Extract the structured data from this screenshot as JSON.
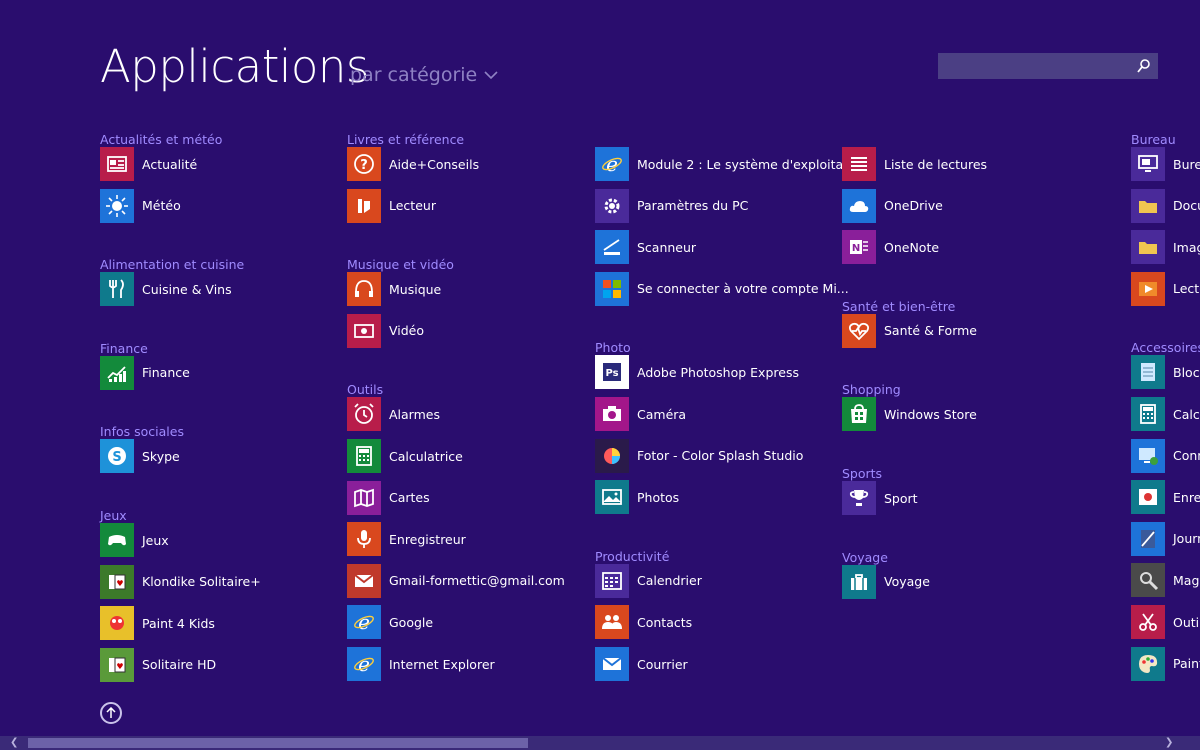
{
  "header": {
    "title": "Applications",
    "sort_label": "par catégorie",
    "search_placeholder": ""
  },
  "colors": {
    "background": "#2a0d6e",
    "section_head": "#a08bff",
    "search_bg": "#4b3f84"
  },
  "columns": [
    {
      "sections": [
        {
          "head": "Actualités et météo",
          "apps": [
            {
              "label": "Actualité",
              "icon": "news-icon",
              "color": "#b81d4a"
            },
            {
              "label": "Météo",
              "icon": "sun-icon",
              "color": "#1e73d9"
            }
          ]
        },
        {
          "head": "Alimentation et cuisine",
          "apps": [
            {
              "label": "Cuisine & Vins",
              "icon": "fork-knife-icon",
              "color": "#0f7a8c"
            }
          ]
        },
        {
          "head": "Finance",
          "apps": [
            {
              "label": "Finance",
              "icon": "chart-icon",
              "color": "#138a3b"
            }
          ]
        },
        {
          "head": "Infos sociales",
          "apps": [
            {
              "label": "Skype",
              "icon": "skype-icon",
              "color": "#1e92d9"
            }
          ]
        },
        {
          "head": "Jeux",
          "apps": [
            {
              "label": "Jeux",
              "icon": "gamepad-icon",
              "color": "#138a3b"
            },
            {
              "label": "Klondike Solitaire+",
              "icon": "cards-icon",
              "color": "#3c7a2a"
            },
            {
              "label": "Paint 4 Kids",
              "icon": "paint-icon",
              "color": "#e8c02a"
            },
            {
              "label": "Solitaire HD",
              "icon": "cards-icon",
              "color": "#5a9a3a"
            }
          ]
        }
      ]
    },
    {
      "sections": [
        {
          "head": "Livres et référence",
          "apps": [
            {
              "label": "Aide+Conseils",
              "icon": "question-icon",
              "color": "#d9481e"
            },
            {
              "label": "Lecteur",
              "icon": "reader-icon",
              "color": "#d9481e"
            }
          ]
        },
        {
          "head": "Musique et vidéo",
          "apps": [
            {
              "label": "Musique",
              "icon": "headphones-icon",
              "color": "#d9481e"
            },
            {
              "label": "Vidéo",
              "icon": "video-icon",
              "color": "#b81d4a"
            }
          ]
        },
        {
          "head": "Outils",
          "apps": [
            {
              "label": "Alarmes",
              "icon": "alarm-icon",
              "color": "#b81d4a"
            },
            {
              "label": "Calculatrice",
              "icon": "calculator-icon",
              "color": "#138a3b"
            },
            {
              "label": "Cartes",
              "icon": "map-icon",
              "color": "#8a1f9a"
            },
            {
              "label": "Enregistreur",
              "icon": "mic-icon",
              "color": "#d9481e"
            },
            {
              "label": "Gmail-formettic@gmail.com",
              "icon": "mail-icon",
              "color": "#c0392b"
            },
            {
              "label": "Google",
              "icon": "ie-icon",
              "color": "#1e73d9"
            },
            {
              "label": "Internet Explorer",
              "icon": "ie-icon",
              "color": "#1e73d9"
            }
          ]
        }
      ]
    },
    {
      "sections": [
        {
          "head": "",
          "apps": [
            {
              "label": "Module 2 : Le système d'exploita...",
              "icon": "ie-icon",
              "color": "#1e73d9"
            },
            {
              "label": "Paramètres du PC",
              "icon": "gear-icon",
              "color": "#4a2a9a"
            },
            {
              "label": "Scanneur",
              "icon": "scanner-icon",
              "color": "#1e73d9"
            },
            {
              "label": "Se connecter à votre compte Mi...",
              "icon": "windows-icon",
              "color": "#1e73d9"
            }
          ]
        },
        {
          "head": "Photo",
          "apps": [
            {
              "label": "Adobe Photoshop Express",
              "icon": "ps-icon",
              "color": "#ffffff"
            },
            {
              "label": "Caméra",
              "icon": "camera-icon",
              "color": "#a3168a"
            },
            {
              "label": "Fotor - Color Splash Studio",
              "icon": "fotor-icon",
              "color": "#2a1a4a"
            },
            {
              "label": "Photos",
              "icon": "photo-icon",
              "color": "#0f7a8c"
            }
          ]
        },
        {
          "head": "Productivité",
          "apps": [
            {
              "label": "Calendrier",
              "icon": "calendar-icon",
              "color": "#4a2a9a"
            },
            {
              "label": "Contacts",
              "icon": "people-icon",
              "color": "#d9481e"
            },
            {
              "label": "Courrier",
              "icon": "envelope-icon",
              "color": "#1e73d9"
            }
          ]
        }
      ]
    },
    {
      "sections": [
        {
          "head": "",
          "apps": [
            {
              "label": "Liste de lectures",
              "icon": "list-icon",
              "color": "#b81d4a"
            },
            {
              "label": "OneDrive",
              "icon": "cloud-icon",
              "color": "#1e73d9"
            },
            {
              "label": "OneNote",
              "icon": "onenote-icon",
              "color": "#8a1f9a"
            }
          ]
        },
        {
          "head": "Santé et bien-être",
          "apps": [
            {
              "label": "Santé & Forme",
              "icon": "heart-icon",
              "color": "#d9481e"
            }
          ]
        },
        {
          "head": "Shopping",
          "apps": [
            {
              "label": "Windows Store",
              "icon": "store-icon",
              "color": "#138a3b"
            }
          ]
        },
        {
          "head": "Sports",
          "apps": [
            {
              "label": "Sport",
              "icon": "trophy-icon",
              "color": "#4a2a9a"
            }
          ]
        },
        {
          "head": "Voyage",
          "apps": [
            {
              "label": "Voyage",
              "icon": "suitcase-icon",
              "color": "#0f7a8c"
            }
          ]
        }
      ]
    },
    {
      "sections": [
        {
          "head": "Bureau",
          "apps": [
            {
              "label": "Burea",
              "icon": "desktop-icon",
              "color": "#4a2a9a"
            },
            {
              "label": "Docu",
              "icon": "folder-icon",
              "color": "#4a2a9a"
            },
            {
              "label": "Imag",
              "icon": "folder-icon",
              "color": "#4a2a9a"
            },
            {
              "label": "Lecte",
              "icon": "media-player-icon",
              "color": "#d9481e"
            }
          ]
        },
        {
          "head": "Accessoires W",
          "apps": [
            {
              "label": "Bloc-",
              "icon": "notepad-icon",
              "color": "#0f7a8c"
            },
            {
              "label": "Calcu",
              "icon": "calculator-icon",
              "color": "#0f7a8c"
            },
            {
              "label": "Conn",
              "icon": "remote-desktop-icon",
              "color": "#1e73d9"
            },
            {
              "label": "Enreg",
              "icon": "sound-recorder-icon",
              "color": "#0f7a8c"
            },
            {
              "label": "Journ",
              "icon": "journal-icon",
              "color": "#1e73d9"
            },
            {
              "label": "Magn",
              "icon": "magnifier-icon",
              "color": "#4a4a4a"
            },
            {
              "label": "Outil",
              "icon": "snipping-icon",
              "color": "#b81d4a"
            },
            {
              "label": "Paint",
              "icon": "palette-icon",
              "color": "#0f7a8c"
            }
          ]
        }
      ]
    }
  ]
}
